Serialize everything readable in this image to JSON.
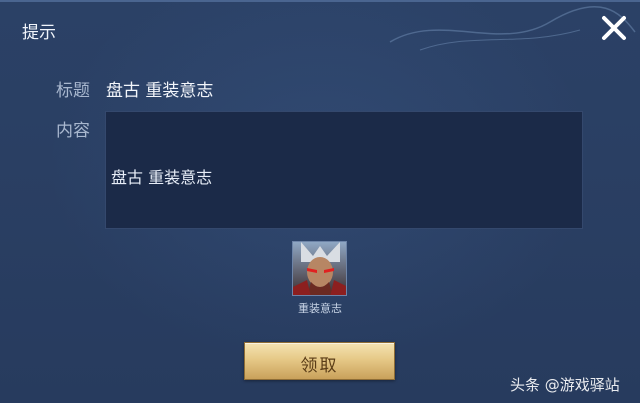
{
  "dialog": {
    "title": "提示",
    "close_icon": "close-icon"
  },
  "fields": {
    "title_label": "标题",
    "title_value": "盘古 重装意志",
    "content_label": "内容",
    "content_value": "盘古 重装意志"
  },
  "reward": {
    "icon": "hero-skin-icon",
    "name": "重装意志"
  },
  "actions": {
    "claim_label": "领取"
  },
  "watermark": {
    "text": "头条 @游戏驿站"
  },
  "colors": {
    "panel_bg": "#2a3f63",
    "content_bg": "#1b2a48",
    "button_gold": "#e6c987",
    "button_text": "#5a3c17"
  }
}
